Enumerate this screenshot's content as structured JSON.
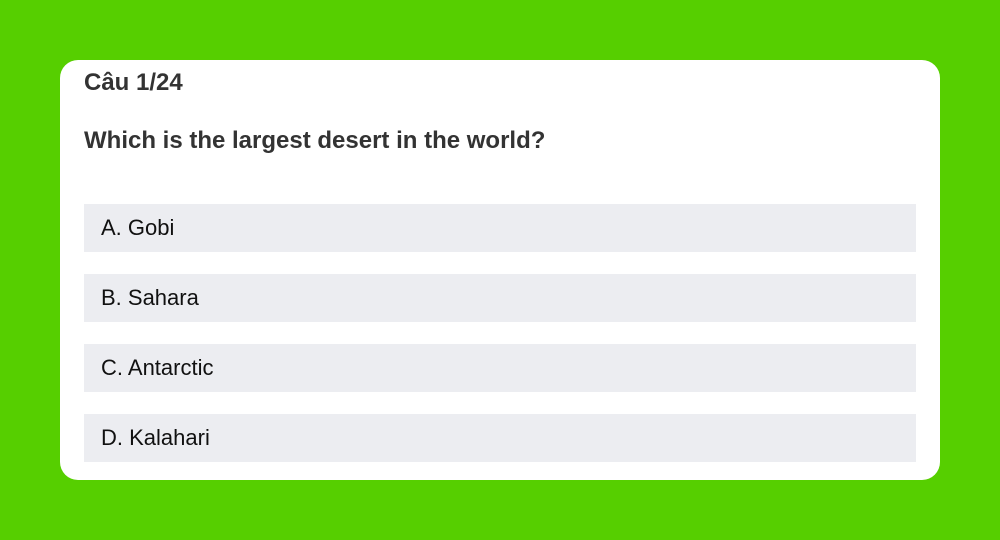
{
  "background_color": "#56cf00",
  "quiz": {
    "counter": "Câu 1/24",
    "question": "Which is the largest desert in the world?",
    "options": [
      {
        "label": "A. Gobi"
      },
      {
        "label": "B. Sahara"
      },
      {
        "label": "C. Antarctic"
      },
      {
        "label": "D. Kalahari"
      }
    ]
  }
}
